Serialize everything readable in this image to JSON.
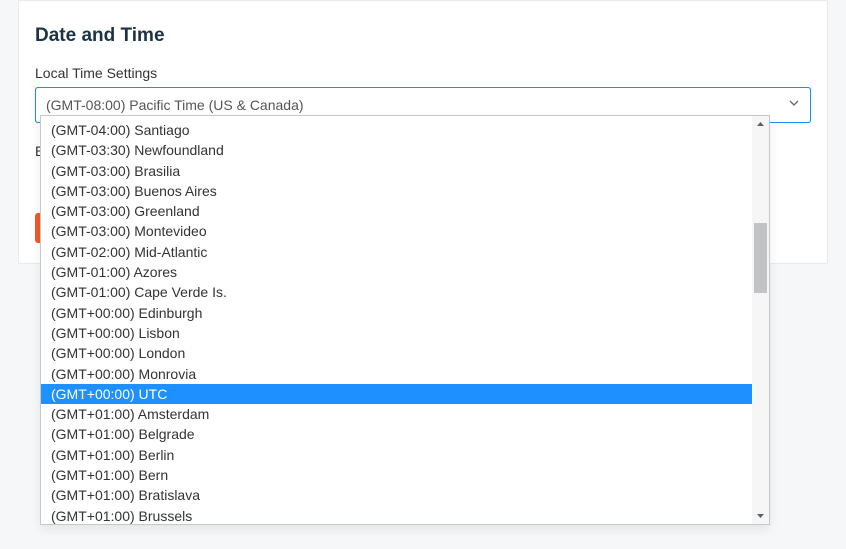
{
  "section": {
    "title": "Date and Time",
    "field_label": "Local Time Settings"
  },
  "select": {
    "value": "(GMT-08:00) Pacific Time (US & Canada)"
  },
  "dropdown": {
    "highlighted_index": 13,
    "options": [
      "(GMT-04:00) Santiago",
      "(GMT-03:30) Newfoundland",
      "(GMT-03:00) Brasilia",
      "(GMT-03:00) Buenos Aires",
      "(GMT-03:00) Greenland",
      "(GMT-03:00) Montevideo",
      "(GMT-02:00) Mid-Atlantic",
      "(GMT-01:00) Azores",
      "(GMT-01:00) Cape Verde Is.",
      "(GMT+00:00) Edinburgh",
      "(GMT+00:00) Lisbon",
      "(GMT+00:00) London",
      "(GMT+00:00) Monrovia",
      "(GMT+00:00) UTC",
      "(GMT+01:00) Amsterdam",
      "(GMT+01:00) Belgrade",
      "(GMT+01:00) Berlin",
      "(GMT+01:00) Bern",
      "(GMT+01:00) Bratislava",
      "(GMT+01:00) Brussels"
    ]
  }
}
